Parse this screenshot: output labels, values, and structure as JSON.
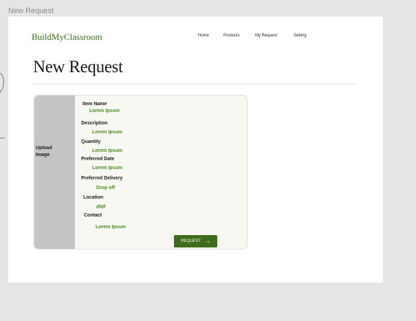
{
  "frame": {
    "label": "New Request"
  },
  "brand": {
    "name": "BuildMyClassroom"
  },
  "nav": {
    "items": [
      "Home",
      "Products",
      "My Request",
      "Setting"
    ]
  },
  "page": {
    "title": "New Request"
  },
  "form": {
    "upload_label": "Upload\nImage",
    "fields": [
      {
        "label": "Item Name",
        "value": "Lorem Ipsum"
      },
      {
        "label": "Description",
        "value": "Lorem Ipsum"
      },
      {
        "label": "Quantity",
        "value": "Lorem Ipsum"
      },
      {
        "label": "Preferred Date",
        "value": "Lorem Ipsum"
      },
      {
        "label": "Preferred Delivery",
        "value": "Drop off"
      },
      {
        "label": "Location",
        "value": "dfdf"
      },
      {
        "label": "Contact",
        "value": "Lorem Ipsum"
      }
    ],
    "submit_label": "REQUEST",
    "submit_icon": "arrow-right-icon"
  },
  "colors": {
    "brand_green": "#3b6a1d",
    "value_green": "#4f8a22",
    "button_green": "#3e6b1c",
    "upload_gray": "#c4c4c4",
    "card_bg": "#f8f8f2"
  }
}
